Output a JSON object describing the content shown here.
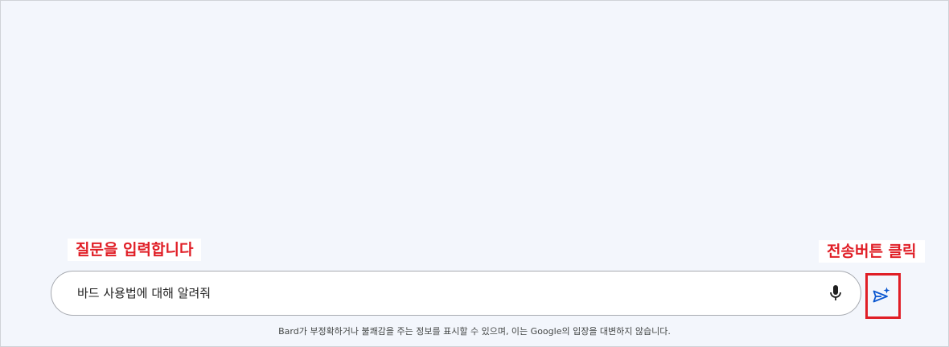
{
  "annotations": {
    "input_hint": "질문을 입력합니다",
    "send_hint": "전송버튼 클릭"
  },
  "prompt": {
    "value": "바드 사용법에 대해 알려줘"
  },
  "icons": {
    "mic": "microphone-icon",
    "send": "send-sparkle-icon"
  },
  "colors": {
    "annotation_red": "#e01e26",
    "page_background": "#f3f6fc",
    "send_icon_blue": "#0b57d0"
  },
  "footer": {
    "disclaimer": "Bard가 부정확하거나 불쾌감을 주는 정보를 표시할 수 있으며, 이는 Google의 입장을 대변하지 않습니다."
  }
}
